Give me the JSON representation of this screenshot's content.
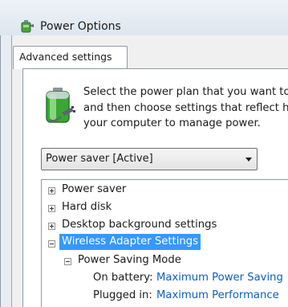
{
  "window": {
    "title": "Power Options"
  },
  "tabs": [
    {
      "label": "Advanced settings",
      "active": true
    }
  ],
  "intro": {
    "lines": [
      "Select the power plan that you want to",
      "and then choose settings that reflect ho",
      "your computer to manage power."
    ]
  },
  "plan_select": {
    "value": "Power saver [Active]"
  },
  "tree": {
    "items": [
      {
        "label": "Power saver",
        "state": "collapsed"
      },
      {
        "label": "Hard disk",
        "state": "collapsed"
      },
      {
        "label": "Desktop background settings",
        "state": "collapsed"
      },
      {
        "label": "Wireless Adapter Settings",
        "state": "expanded",
        "selected": true
      }
    ],
    "sub_item": {
      "label": "Power Saving Mode",
      "state": "expanded"
    },
    "settings": [
      {
        "label": "On battery:",
        "value": "Maximum Power Saving"
      },
      {
        "label": "Plugged in:",
        "value": "Maximum Performance"
      }
    ]
  },
  "colors": {
    "selection": "#3399ff",
    "link_value": "#0b5fbe",
    "battery_green": "#3aa635"
  },
  "icons": {
    "title": "power-options-icon",
    "intro": "battery-plug-icon",
    "dropdown": "chevron-down-icon"
  }
}
